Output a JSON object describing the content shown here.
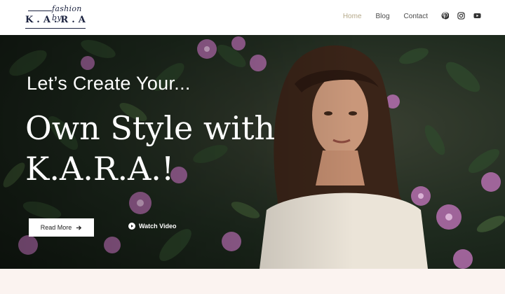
{
  "brand": {
    "script": "fashion by",
    "name": "K.A.R.A"
  },
  "nav": {
    "items": [
      {
        "label": "Home",
        "active": true
      },
      {
        "label": "Blog",
        "active": false
      },
      {
        "label": "Contact",
        "active": false
      }
    ],
    "active_color": "#b5a98a"
  },
  "social": [
    "pinterest-icon",
    "instagram-icon",
    "youtube-icon"
  ],
  "hero": {
    "subtitle": "Let’s Create Your...",
    "title": "Own Style with K.A.R.A.!",
    "read_more_label": "Read More",
    "watch_video_label": "Watch Video"
  },
  "colors": {
    "brand_navy": "#1c2340",
    "bottom_band": "#fbf3f0"
  }
}
